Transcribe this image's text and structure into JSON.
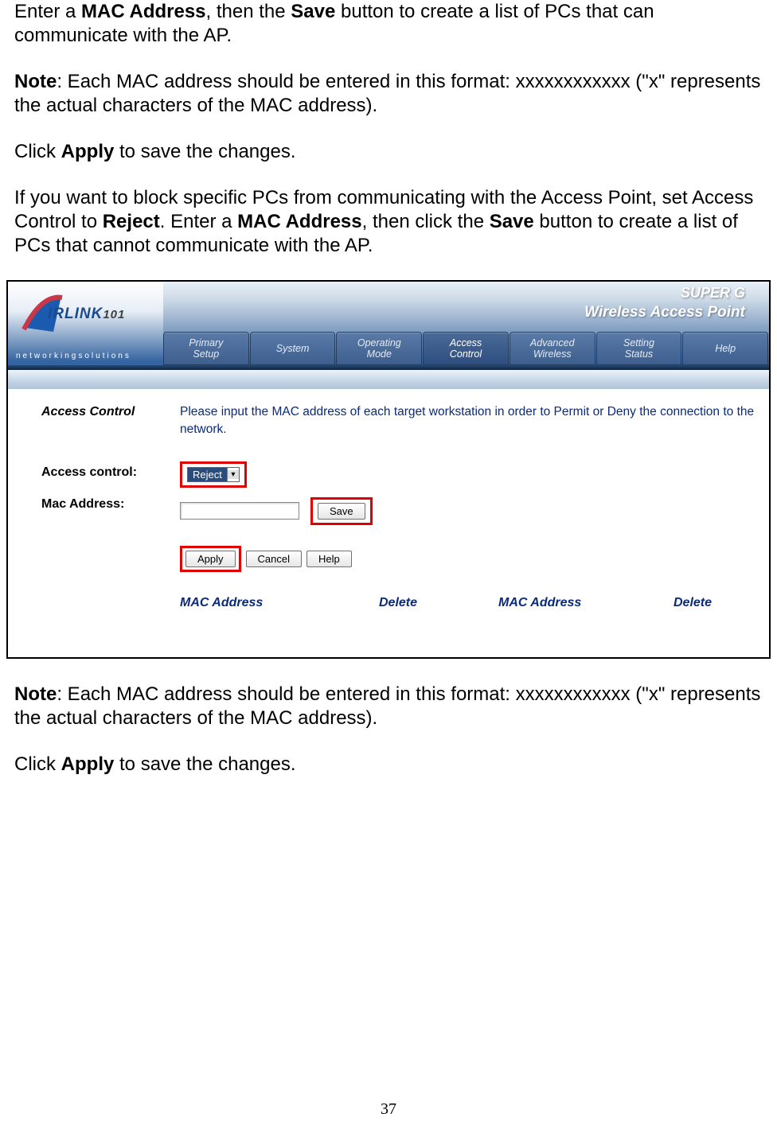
{
  "text": {
    "p1a": "Enter a ",
    "p1b": "MAC Address",
    "p1c": ", then the ",
    "p1d": "Save",
    "p1e": " button to create a list of PCs that can communicate with the AP.",
    "p2a": "Note",
    "p2b": ": Each MAC address should be entered in this format: xxxxxxxxxxxx (\"x\" represents the actual characters of the MAC address).",
    "p3a": "Click ",
    "p3b": "Apply",
    "p3c": " to save the changes.",
    "p4a": "If you want to block specific PCs from communicating with the Access Point, set Access Control to ",
    "p4b": "Reject",
    "p4c": ".  Enter a ",
    "p4d": "MAC Address",
    "p4e": ", then click the ",
    "p4f": "Save",
    "p4g": " button to create a list of PCs that cannot communicate with the AP.",
    "p5a": "Note",
    "p5b": ": Each MAC address should be entered in this format: xxxxxxxxxxxx (\"x\" represents the actual characters of the MAC address).",
    "p6a": "Click ",
    "p6b": "Apply",
    "p6c": " to save the changes."
  },
  "pageNumber": "37",
  "screenshot": {
    "logo": {
      "brand1": "IRLINK",
      "brand2": "101",
      "subtitle": "networkingsolutions"
    },
    "banner": {
      "title1": "SUPER G",
      "title2": "Wireless Access Point"
    },
    "nav": [
      {
        "l1": "Primary",
        "l2": "Setup"
      },
      {
        "l1": "System",
        "l2": ""
      },
      {
        "l1": "Operating",
        "l2": "Mode"
      },
      {
        "l1": "Access",
        "l2": "Control"
      },
      {
        "l1": "Advanced",
        "l2": "Wireless"
      },
      {
        "l1": "Setting",
        "l2": "Status"
      },
      {
        "l1": "Help",
        "l2": ""
      }
    ],
    "labels": {
      "heading": "Access Control",
      "accessControl": "Access control:",
      "macAddress": "Mac Address:"
    },
    "instruction": "Please input the MAC address of each target workstation in order to Permit or Deny the connection to the network.",
    "dropdownValue": "Reject",
    "saveBtn": "Save",
    "applyBtn": "Apply",
    "cancelBtn": "Cancel",
    "helpBtn": "Help",
    "tableHeaders": {
      "mac": "MAC Address",
      "delete": "Delete"
    }
  }
}
